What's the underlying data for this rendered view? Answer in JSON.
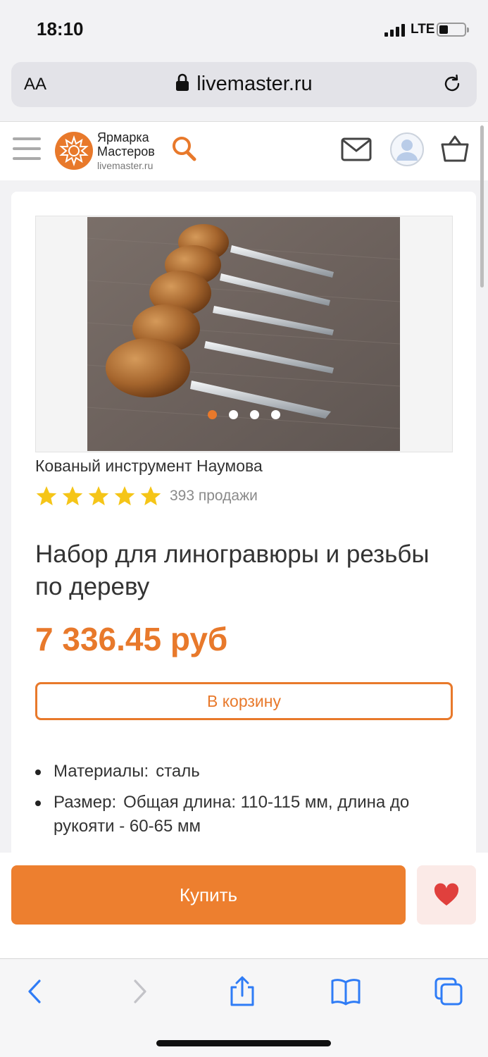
{
  "status_bar": {
    "time": "18:10",
    "network": "LTE"
  },
  "address_bar": {
    "text_size_label": "AA",
    "url": "livemaster.ru"
  },
  "site_header": {
    "logo_line1": "Ярмарка",
    "logo_line2": "Мастеров",
    "logo_domain": "livemaster.ru"
  },
  "product": {
    "shop_name": "Кованый инструмент Наумова",
    "rating_stars": 5,
    "sales_count": "393 продажи",
    "title": "Набор для линогравюры и резьбы по дереву",
    "price": "7 336.45 руб",
    "add_to_cart_label": "В корзину",
    "gallery": {
      "total_images": 4,
      "active_index": 0
    },
    "properties": [
      {
        "key": "Материалы:",
        "value": "сталь"
      },
      {
        "key": "Размер:",
        "value": "Общая длина: 110-115 мм, длина до рукояти - 60-65 мм"
      }
    ]
  },
  "buy_bar": {
    "buy_label": "Купить",
    "favorite_icon": "heart-icon"
  },
  "colors": {
    "accent": "#e8792b",
    "star": "#f5c518",
    "heart": "#e0403d",
    "ios_blue": "#2f7cf6"
  },
  "toolbar_icons": [
    "back-icon",
    "forward-icon",
    "share-icon",
    "bookmarks-icon",
    "tabs-icon"
  ]
}
